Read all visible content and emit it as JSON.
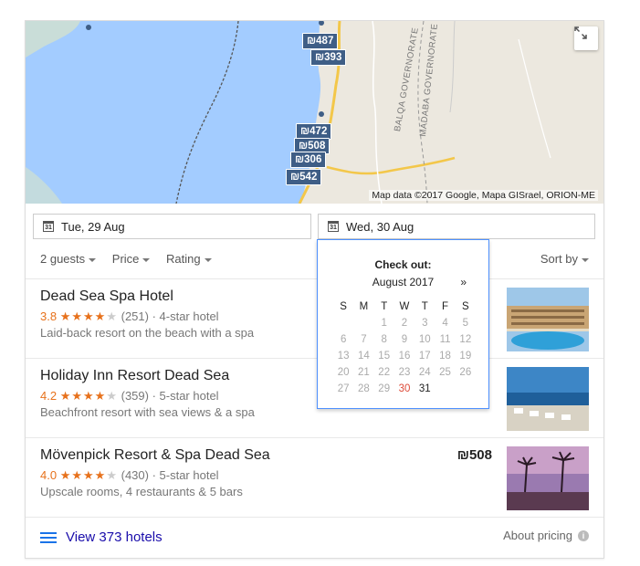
{
  "map": {
    "pins": [
      "₪487",
      "₪393",
      "₪472",
      "₪508",
      "₪306",
      "₪542"
    ],
    "labels": [
      "BALQA GOVERNORATE",
      "MADABA GOVERNORATE"
    ],
    "credit": "Map data ©2017 Google, Mapa GISrael, ORION-ME",
    "expand_icon": "expand-icon"
  },
  "dates": {
    "check_in": "Tue, 29 Aug",
    "check_out": "Wed, 30 Aug",
    "icon_text": "31"
  },
  "filters": {
    "guests": "2 guests",
    "price": "Price",
    "rating": "Rating",
    "sort": "Sort by"
  },
  "hotels": [
    {
      "name": "Dead Sea Spa Hotel",
      "score": "3.8",
      "stars": 4,
      "reviews": "(251)",
      "class": "4-star hotel",
      "desc": "Laid-back resort on the beach with a spa",
      "price": ""
    },
    {
      "name": "Holiday Inn Resort Dead Sea",
      "score": "4.2",
      "stars": 4,
      "reviews": "(359)",
      "class": "5-star hotel",
      "desc": "Beachfront resort with sea views & a spa",
      "price": ""
    },
    {
      "name": "Mövenpick Resort & Spa Dead Sea",
      "score": "4.0",
      "stars": 4,
      "reviews": "(430)",
      "class": "5-star hotel",
      "desc": "Upscale rooms, 4 restaurants & 5 bars",
      "price": "₪508"
    }
  ],
  "calendar": {
    "title": "Check out:",
    "month": "August 2017",
    "next": "»",
    "weekdays": [
      "S",
      "M",
      "T",
      "W",
      "T",
      "F",
      "S"
    ],
    "weeks": [
      [
        "",
        "",
        "1",
        "2",
        "3",
        "4",
        "5"
      ],
      [
        "6",
        "7",
        "8",
        "9",
        "10",
        "11",
        "12"
      ],
      [
        "13",
        "14",
        "15",
        "16",
        "17",
        "18",
        "19"
      ],
      [
        "20",
        "21",
        "22",
        "23",
        "24",
        "25",
        "26"
      ],
      [
        "27",
        "28",
        "29",
        "30",
        "31",
        "",
        ""
      ]
    ],
    "selected": "30",
    "active": [
      "31"
    ]
  },
  "footer": {
    "view_all": "View 373 hotels",
    "about": "About pricing",
    "info": "i"
  },
  "colors": {
    "sea": "#a3ccff",
    "land": "#ece8df",
    "pin": "#3f5e86",
    "star": "#e7711b",
    "link": "#1a0dab",
    "selected_day": "#dd4b39"
  }
}
